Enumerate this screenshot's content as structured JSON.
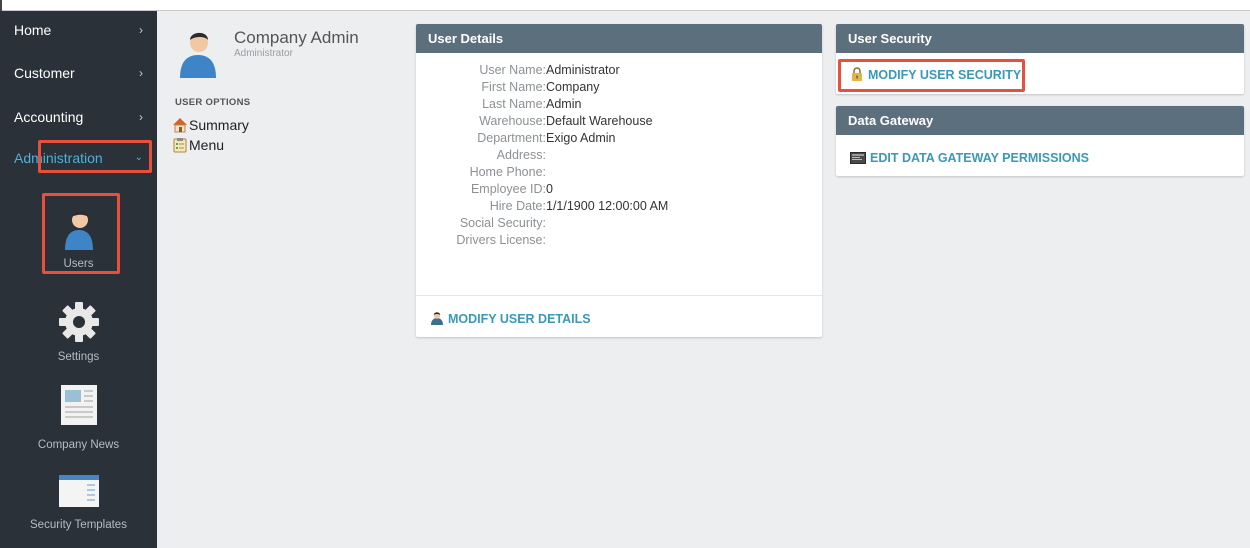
{
  "sidebar": {
    "nav": [
      {
        "label": "Home",
        "chevron": "›"
      },
      {
        "label": "Customer",
        "chevron": "›"
      },
      {
        "label": "Accounting",
        "chevron": "›"
      },
      {
        "label": "Administration",
        "chevron": "⌄"
      }
    ],
    "tools": [
      {
        "label": "Users",
        "icon": "user-icon"
      },
      {
        "label": "Settings",
        "icon": "gear-icon"
      },
      {
        "label": "Company News",
        "icon": "newspaper-icon"
      },
      {
        "label": "Security Templates",
        "icon": "window-icon"
      }
    ],
    "active_color": "#4fb1d8"
  },
  "profile": {
    "name": "Company Admin",
    "role": "Administrator",
    "options_title": "USER OPTIONS",
    "options": [
      {
        "label": "Summary",
        "icon": "house-icon"
      },
      {
        "label": "Menu",
        "icon": "clipboard-icon"
      }
    ]
  },
  "user_details": {
    "title": "User Details",
    "fields": [
      {
        "label": "User Name:",
        "value": "Administrator"
      },
      {
        "label": "First Name:",
        "value": "Company"
      },
      {
        "label": "Last Name:",
        "value": "Admin"
      },
      {
        "label": "Warehouse:",
        "value": "Default Warehouse"
      },
      {
        "label": "Department:",
        "value": "Exigo Admin"
      },
      {
        "label": "Address:",
        "value": ""
      },
      {
        "label": "Home Phone:",
        "value": ""
      },
      {
        "label": "Employee ID:",
        "value": "0"
      },
      {
        "label": "Hire Date:",
        "value": "1/1/1900 12:00:00 AM"
      },
      {
        "label": "Social Security:",
        "value": ""
      },
      {
        "label": "Drivers License:",
        "value": ""
      }
    ],
    "action": "MODIFY USER DETAILS"
  },
  "user_security": {
    "title": "User Security",
    "action": "MODIFY USER SECURITY"
  },
  "data_gateway": {
    "title": "Data Gateway",
    "action": "EDIT DATA GATEWAY PERMISSIONS"
  },
  "colors": {
    "panel_header": "#5c6f7d",
    "link": "#3a98b9",
    "highlight": "#e8503c",
    "sidebar_bg": "#2a3138"
  }
}
